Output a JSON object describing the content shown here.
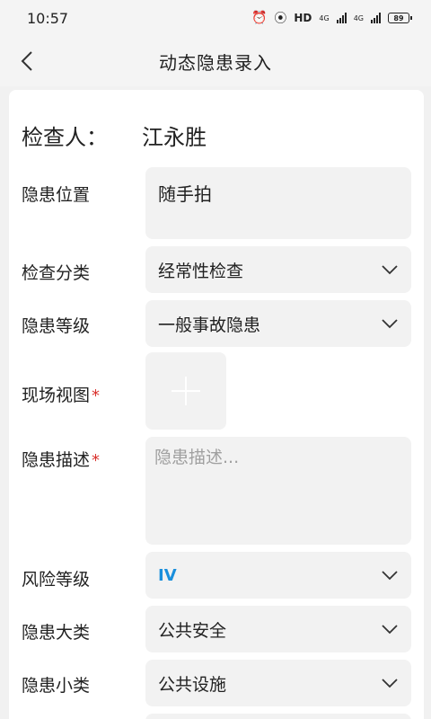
{
  "status": {
    "time": "10:57",
    "network_label": "HD",
    "net1": "4G",
    "net2": "4G",
    "battery": "89"
  },
  "nav": {
    "title": "动态隐患录入"
  },
  "form": {
    "inspector_label": "检查人：",
    "inspector_value": "江永胜",
    "location_label": "隐患位置",
    "location_value": "随手拍",
    "category_label": "检查分类",
    "category_value": "经常性检查",
    "level_label": "隐患等级",
    "level_value": "一般事故隐患",
    "photo_label": "现场视图",
    "description_label": "隐患描述",
    "description_placeholder": "隐患描述...",
    "risk_label": "风险等级",
    "risk_value": "IV",
    "major_type_label": "隐患大类",
    "major_type_value": "公共安全",
    "minor_type_label": "隐患小类",
    "minor_type_value": "公共设施",
    "required_mark": "*"
  },
  "colors": {
    "required": "#d9312c",
    "risk_value": "#1a8fdc",
    "field_bg": "#f2f2f2"
  },
  "icons": {
    "back": "chevron-left-icon",
    "dropdown": "chevron-down-icon",
    "add": "plus-icon"
  }
}
